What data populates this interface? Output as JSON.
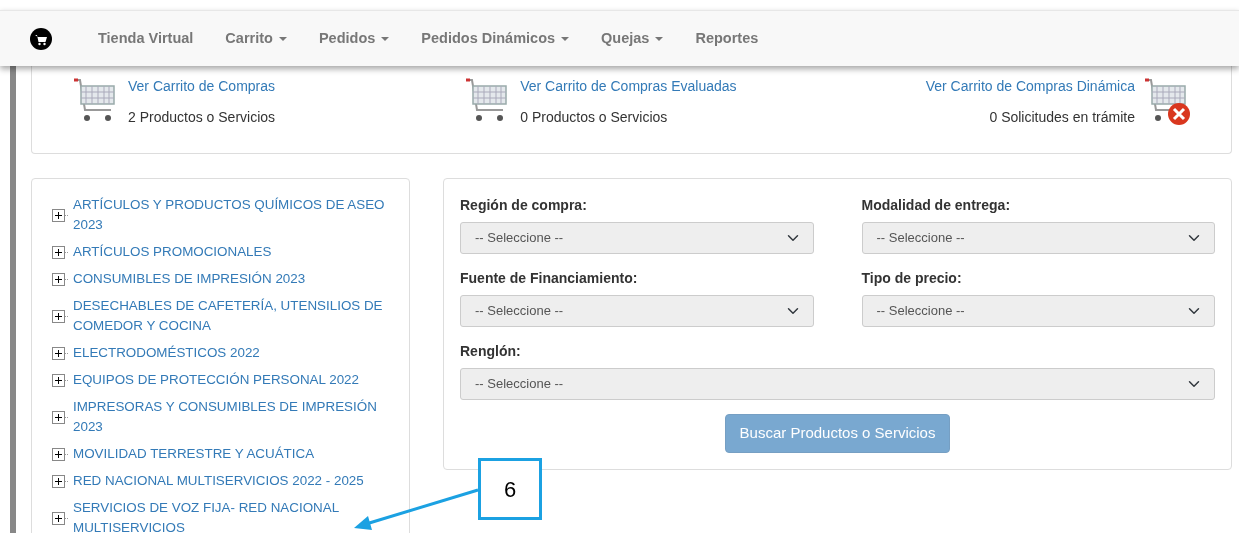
{
  "navbar": {
    "items": [
      {
        "label": "Tienda Virtual",
        "dropdown": false
      },
      {
        "label": "Carrito",
        "dropdown": true
      },
      {
        "label": "Pedidos",
        "dropdown": true
      },
      {
        "label": "Pedidos Dinámicos",
        "dropdown": true
      },
      {
        "label": "Quejas",
        "dropdown": true
      },
      {
        "label": "Reportes",
        "dropdown": false
      }
    ]
  },
  "carts": [
    {
      "link": "Ver Carrito de Compras",
      "count": "2 Productos o Servicios",
      "kind": "plain"
    },
    {
      "link": "Ver Carrito de Compras Evaluadas",
      "count": "0 Productos o Servicios",
      "kind": "plain"
    },
    {
      "link": "Ver Carrito de Compras Dinámica",
      "count": "0 Solicitudes en trámite",
      "kind": "error"
    }
  ],
  "categories": [
    {
      "label": "ARTÍCULOS Y PRODUCTOS QUÍMICOS DE ASEO 2023",
      "expanded": false
    },
    {
      "label": "ARTÍCULOS PROMOCIONALES",
      "expanded": false
    },
    {
      "label": "CONSUMIBLES DE IMPRESIÓN 2023",
      "expanded": false
    },
    {
      "label": "DESECHABLES DE CAFETERÍA, UTENSILIOS DE COMEDOR Y COCINA",
      "expanded": false
    },
    {
      "label": "ELECTRODOMÉSTICOS 2022",
      "expanded": false
    },
    {
      "label": "EQUIPOS DE PROTECCIÓN PERSONAL 2022",
      "expanded": false
    },
    {
      "label": "IMPRESORAS Y CONSUMIBLES DE IMPRESIÓN 2023",
      "expanded": false
    },
    {
      "label": "MOVILIDAD TERRESTRE Y ACUÁTICA",
      "expanded": false
    },
    {
      "label": "RED NACIONAL MULTISERVICIOS 2022 - 2025",
      "expanded": false
    },
    {
      "label": "SERVICIOS DE VOZ FIJA- RED NACIONAL MULTISERVICIOS",
      "expanded": false
    }
  ],
  "filters": [
    {
      "label": "Región de compra:",
      "value": "-- Seleccione --",
      "kind": "half"
    },
    {
      "label": "Modalidad de entrega:",
      "value": "-- Seleccione --",
      "kind": "half"
    },
    {
      "label": "Fuente de Financiamiento:",
      "value": "-- Seleccione --",
      "kind": "half"
    },
    {
      "label": "Tipo de precio:",
      "value": "-- Seleccione --",
      "kind": "half"
    },
    {
      "label": "Renglón:",
      "value": "-- Seleccione --",
      "kind": "full"
    }
  ],
  "search_button": {
    "label": "Buscar Productos o Servicios",
    "disabled": true
  },
  "callout": {
    "label": "6"
  }
}
